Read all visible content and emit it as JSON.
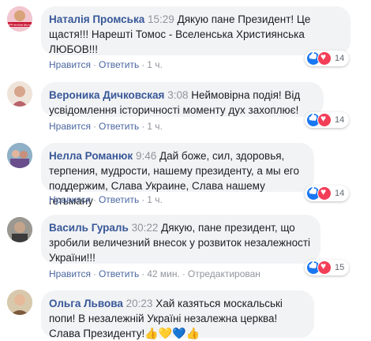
{
  "actions": {
    "like": "Нравится",
    "reply": "Ответить",
    "edited": "Отредактирован"
  },
  "comments": [
    {
      "author": "Наталія Промська",
      "time": "15:29",
      "text": "Дякую пане Президент! Це щастя!!! Нарешті Томос - Вселенська Християнська ЛЮБОВ!!!",
      "age": "1 ч.",
      "reactions": "14",
      "avatar_text": "#FreeSentsov"
    },
    {
      "author": "Вероника Дичковская",
      "time": "3:08",
      "text": "Неймовірна подія! Від усвідомлення історичності моменту дух захоплює!",
      "age": "1 ч.",
      "reactions": "14"
    },
    {
      "author": "Нелла Романюк",
      "time": "9:46",
      "text": "Дай боже, сил, здоровья, терпения, мудрости, нашему президенту, а мы его поддержим, Слава Украине, Слава нашему гетьману",
      "age": "1 ч.",
      "reactions": "14"
    },
    {
      "author": "Василь Гураль",
      "time": "30:22",
      "text": "Дякую, пане президент, що зробили величезний внесок у розвиток незалежності України!!!",
      "age": "42 мин.",
      "reactions": "15"
    },
    {
      "author": "Ольга Львова",
      "time": "20:23",
      "text": "Хай казяться москальські попи! В незалежній Україні незалежна церква! Слава Президенту!",
      "emoji": "👍💛💙👍"
    }
  ],
  "colors": {
    "author": "#385898",
    "bubble": "#f2f3f5",
    "like": "#1877f2",
    "love": "#f33e58"
  }
}
